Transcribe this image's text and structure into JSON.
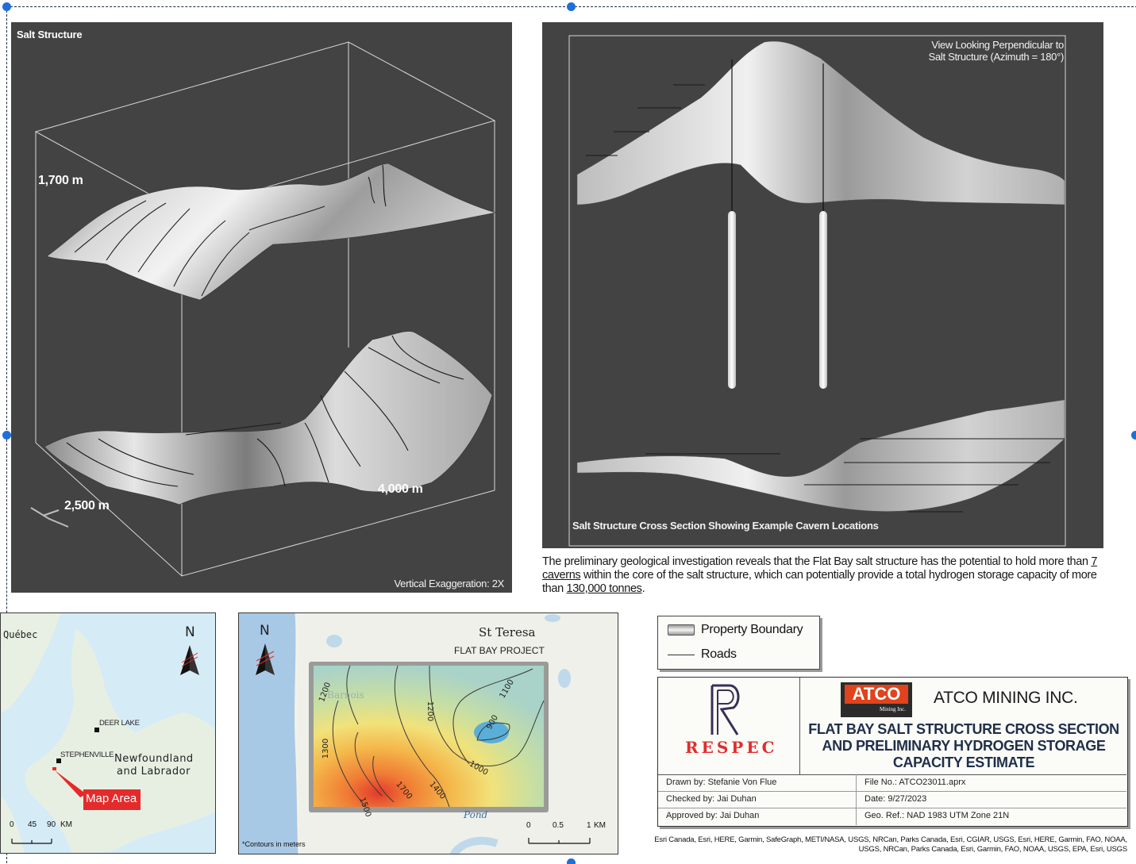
{
  "salt_structure": {
    "title": "Salt Structure",
    "height_label": "1,700 m",
    "width_label": "2,500 m",
    "length_label": "4,000 m",
    "exaggeration": "Vertical Exaggeration: 2X"
  },
  "cross_section": {
    "view_note_line1": "View Looking Perpendicular to",
    "view_note_line2": "Salt Structure (Azimuth = 180°)",
    "caption": "Salt Structure Cross Section Showing Example Cavern Locations"
  },
  "description": {
    "part1": "The preliminary geological investigation reveals that the Flat Bay salt structure has the potential to hold more than ",
    "caverns": "7 caverns",
    "part2": " within the core of the salt structure, which can potentially provide a total hydrogen storage capacity of more than ",
    "tonnes": "130,000 tonnes",
    "part3": "."
  },
  "locator_map": {
    "north": "N",
    "quebec": "Québec",
    "deer_lake": "DEER LAKE",
    "stephenville": "STEPHENVILLE",
    "province_line1": "Newfoundland",
    "province_line2": "and Labrador",
    "map_area": "Map Area",
    "scale": [
      "0",
      "45",
      "90",
      "KM"
    ],
    "colors": {
      "water": "#d5ecf7",
      "land": "#e7efe2",
      "highlight": "#e32b2b"
    }
  },
  "project_map": {
    "north": "N",
    "place": "St Teresa",
    "project": "FLAT BAY PROJECT",
    "faded_place": "Barnois",
    "pond": "Pond",
    "contours": [
      "1200",
      "1200",
      "1100",
      "900",
      "1000",
      "1300",
      "1400",
      "1500",
      "1700"
    ],
    "note": "*Contours in meters",
    "scale": [
      "0",
      "0.5",
      "1",
      "KM"
    ]
  },
  "legend": {
    "items": [
      "Property Boundary",
      "Roads"
    ]
  },
  "title_block": {
    "respec": "RESPEC",
    "atco_logo": "ATCO",
    "atco_sub": "Mining Inc.",
    "company": "ATCO MINING INC.",
    "title_line1": "FLAT BAY SALT STRUCTURE CROSS SECTION",
    "title_line2": "AND PRELIMINARY HYDROGEN STORAGE",
    "title_line3": "CAPACITY ESTIMATE",
    "drawn": "Drawn by: Stefanie Von Flue",
    "checked": "Checked by: Jai Duhan",
    "approved": "Approved by: Jai Duhan",
    "file": "File No.: ATCO23011.aprx",
    "date": "Date: 9/27/2023",
    "georef": "Geo. Ref.: NAD 1983 UTM Zone 21N"
  },
  "credits": {
    "line1": "Esri Canada, Esri, HERE, Garmin, SafeGraph, METI/NASA, USGS, NRCan, Parks Canada, Esri, CGIAR, USGS, Esri, HERE, Garmin, FAO, NOAA,",
    "line2": "USGS, NRCan, Parks Canada, Esri, Garmin, FAO, NOAA, USGS, EPA, Esri, USGS"
  }
}
